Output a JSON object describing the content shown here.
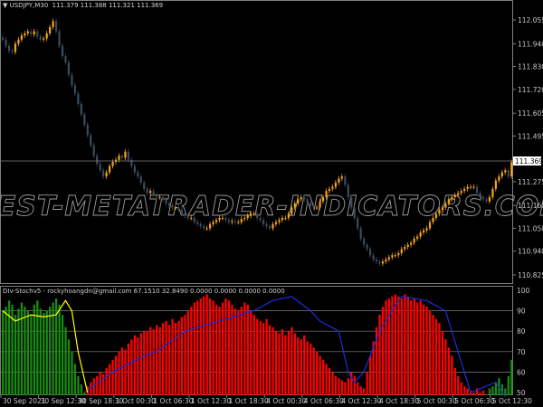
{
  "header": {
    "symbol": "USDJPY,M30",
    "ohlc": "111.379 111.388 111.321 111.369"
  },
  "indicator_header": "DIv-Stochv5 - rockyhoangdn@gmail.com 67.1510 32.8490 0.0000 0.0000 0.0000 0.0000",
  "watermark": "BEST-METATRADER-INDICATORS.COM",
  "colors": {
    "bull": "#f5a31a",
    "bear": "#3d4b5c",
    "hist_up": "#1a8a12",
    "hist_down": "#ff0000",
    "line_blue": "#1c2fd8",
    "line_yellow": "#ffff00",
    "grid": "#808080"
  },
  "chart_data": [
    {
      "type": "candlestick",
      "title": "USDJPY,M30",
      "current_price": "111.369",
      "price_ticks": [
        "112.055",
        "111.940",
        "111.830",
        "111.720",
        "111.605",
        "111.495",
        "111.275",
        "111.160",
        "111.050",
        "110.940",
        "110.825"
      ],
      "ylim": [
        110.825,
        112.055
      ],
      "closes": [
        111.96,
        111.93,
        111.905,
        111.9,
        111.94,
        111.96,
        111.98,
        111.99,
        112.0,
        111.985,
        112.0,
        111.975,
        111.96,
        111.965,
        111.99,
        112.02,
        112.05,
        112.0,
        111.93,
        111.88,
        111.85,
        111.79,
        111.74,
        111.7,
        111.65,
        111.6,
        111.55,
        111.5,
        111.45,
        111.4,
        111.36,
        111.33,
        111.3,
        111.32,
        111.35,
        111.37,
        111.38,
        111.4,
        111.39,
        111.42,
        111.38,
        111.35,
        111.32,
        111.3,
        111.27,
        111.24,
        111.22,
        111.23,
        111.21,
        111.2,
        111.2,
        111.19,
        111.17,
        111.16,
        111.15,
        111.15,
        111.14,
        111.12,
        111.11,
        111.1,
        111.1,
        111.08,
        111.07,
        111.06,
        111.05,
        111.05,
        111.07,
        111.08,
        111.09,
        111.1,
        111.1,
        111.09,
        111.08,
        111.085,
        111.08,
        111.08,
        111.095,
        111.1,
        111.11,
        111.12,
        111.12,
        111.1,
        111.09,
        111.07,
        111.06,
        111.05,
        111.07,
        111.08,
        111.09,
        111.1,
        111.1,
        111.12,
        111.15,
        111.17,
        111.19,
        111.2,
        111.19,
        111.17,
        111.16,
        111.15,
        111.15,
        111.18,
        111.2,
        111.23,
        111.24,
        111.25,
        111.27,
        111.29,
        111.3,
        111.26,
        111.2,
        111.15,
        111.1,
        111.05,
        111.0,
        110.97,
        110.95,
        110.92,
        110.9,
        110.89,
        110.88,
        110.89,
        110.9,
        110.91,
        110.92,
        110.92,
        110.93,
        110.95,
        110.96,
        110.97,
        110.98,
        111.0,
        111.01,
        111.03,
        111.04,
        111.05,
        111.08,
        111.1,
        111.12,
        111.14,
        111.15,
        111.17,
        111.19,
        111.2,
        111.21,
        111.22,
        111.23,
        111.24,
        111.25,
        111.25,
        111.25,
        111.22,
        111.2,
        111.19,
        111.18,
        111.2,
        111.24,
        111.28,
        111.3,
        111.32,
        111.33,
        111.3,
        111.369
      ]
    },
    {
      "type": "bar",
      "title": "DIv-Stochv5",
      "ylim": [
        50,
        100
      ],
      "y_ticks": [
        "100",
        "90",
        "80",
        "70",
        "60",
        "50"
      ],
      "grid": true,
      "hist": [
        90,
        92,
        95,
        93,
        88,
        91,
        94,
        92,
        90,
        88,
        93,
        95,
        91,
        89,
        90,
        92,
        94,
        96,
        93,
        88,
        82,
        76,
        70,
        64,
        58,
        54,
        50,
        53,
        55,
        57,
        58,
        60,
        59,
        62,
        64,
        66,
        68,
        70,
        72,
        71,
        74,
        76,
        78,
        77,
        79,
        80,
        80,
        82,
        81,
        83,
        82,
        84,
        85,
        83,
        86,
        84,
        85,
        87,
        88,
        90,
        92,
        94,
        95,
        96,
        97,
        98,
        96,
        95,
        93,
        92,
        94,
        96,
        95,
        93,
        91,
        90,
        92,
        94,
        93,
        90,
        88,
        86,
        85,
        84,
        86,
        83,
        82,
        80,
        79,
        81,
        78,
        80,
        82,
        79,
        77,
        76,
        78,
        75,
        74,
        72,
        70,
        68,
        66,
        64,
        62,
        60,
        58,
        57,
        56,
        55,
        57,
        60,
        58,
        55,
        53,
        52,
        60,
        68,
        75,
        82,
        88,
        92,
        95,
        96,
        97,
        98,
        97,
        96,
        98,
        97,
        95,
        96,
        94,
        95,
        93,
        92,
        90,
        88,
        86,
        84,
        80,
        76,
        72,
        68,
        62,
        58,
        55,
        53,
        52,
        51,
        50,
        52,
        50,
        51,
        49,
        52,
        53,
        55,
        57,
        54,
        52,
        58,
        66
      ],
      "hist_up_ranges": [
        [
          0,
          26
        ],
        [
          155,
          162
        ]
      ],
      "blue_line": [
        [
          26,
          50
        ],
        [
          35,
          60
        ],
        [
          45,
          68
        ],
        [
          49,
          70
        ],
        [
          58,
          80
        ],
        [
          69,
          85
        ],
        [
          80,
          90
        ],
        [
          86,
          95
        ],
        [
          92,
          97
        ],
        [
          98,
          90
        ],
        [
          101,
          85
        ],
        [
          107,
          80
        ],
        [
          110,
          60
        ],
        [
          112,
          55
        ],
        [
          115,
          60
        ],
        [
          120,
          80
        ],
        [
          124,
          90
        ],
        [
          127,
          97
        ],
        [
          135,
          95
        ],
        [
          141,
          90
        ],
        [
          145,
          70
        ],
        [
          149,
          50
        ],
        [
          157,
          55
        ],
        [
          160,
          48
        ]
      ],
      "yellow_line": [
        [
          0,
          90
        ],
        [
          4,
          85
        ],
        [
          9,
          88
        ],
        [
          13,
          87
        ],
        [
          17,
          88
        ],
        [
          20,
          95
        ],
        [
          22,
          90
        ],
        [
          24,
          70
        ],
        [
          27,
          50
        ]
      ]
    }
  ],
  "time_axis": [
    "30 Sep 2021",
    "30 Sep 12:30",
    "30 Sep 18:30",
    "1 Oct 00:30",
    "1 Oct 06:30",
    "1 Oct 12:30",
    "1 Oct 18:30",
    "4 Oct 00:30",
    "4 Oct 06:30",
    "4 Oct 12:30",
    "4 Oct 18:30",
    "5 Oct 00:30",
    "5 Oct 06:30",
    "5 Oct 12:30"
  ]
}
